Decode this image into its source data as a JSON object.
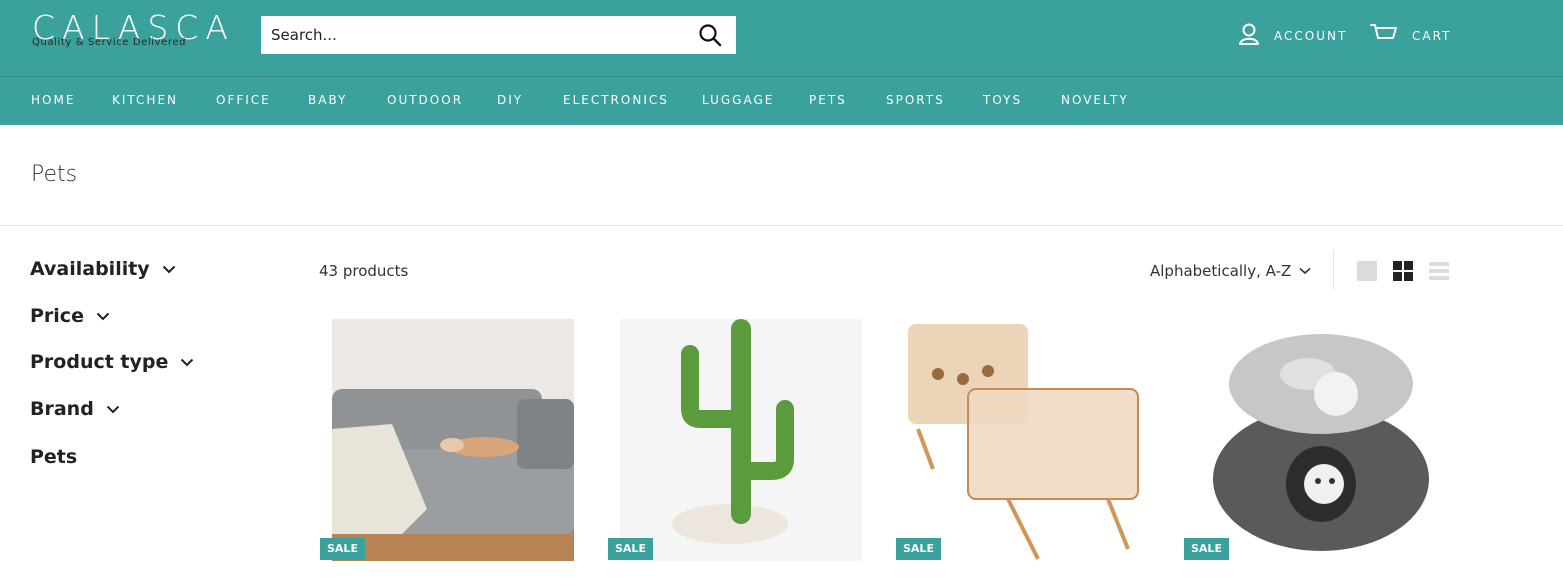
{
  "brand": {
    "name": "CALASCA",
    "tagline": "Quality & Service Delivered"
  },
  "search": {
    "placeholder": "Search..."
  },
  "header_links": {
    "account": "ACCOUNT",
    "cart": "CART"
  },
  "nav": [
    "HOME",
    "KITCHEN",
    "OFFICE",
    "BABY",
    "OUTDOOR",
    "DIY",
    "ELECTRONICS",
    "LUGGAGE",
    "PETS",
    "SPORTS",
    "TOYS",
    "NOVELTY"
  ],
  "page_title": "Pets",
  "filters": [
    "Availability",
    "Price",
    "Product type",
    "Brand"
  ],
  "filter_plain": "Pets",
  "toolbar": {
    "count": "43 products",
    "sort": "Alphabetically, A-Z"
  },
  "products": [
    {
      "image": "gray-sofa-with-dog",
      "badge": "SALE"
    },
    {
      "image": "cactus-cat-scratcher",
      "badge": "SALE"
    },
    {
      "image": "elevated-pet-bowls",
      "badge": "SALE"
    },
    {
      "image": "felt-cat-donut-tunnel",
      "badge": "SALE"
    }
  ],
  "colors": {
    "header": "#3aa19c",
    "badge": "#3aa19c"
  }
}
